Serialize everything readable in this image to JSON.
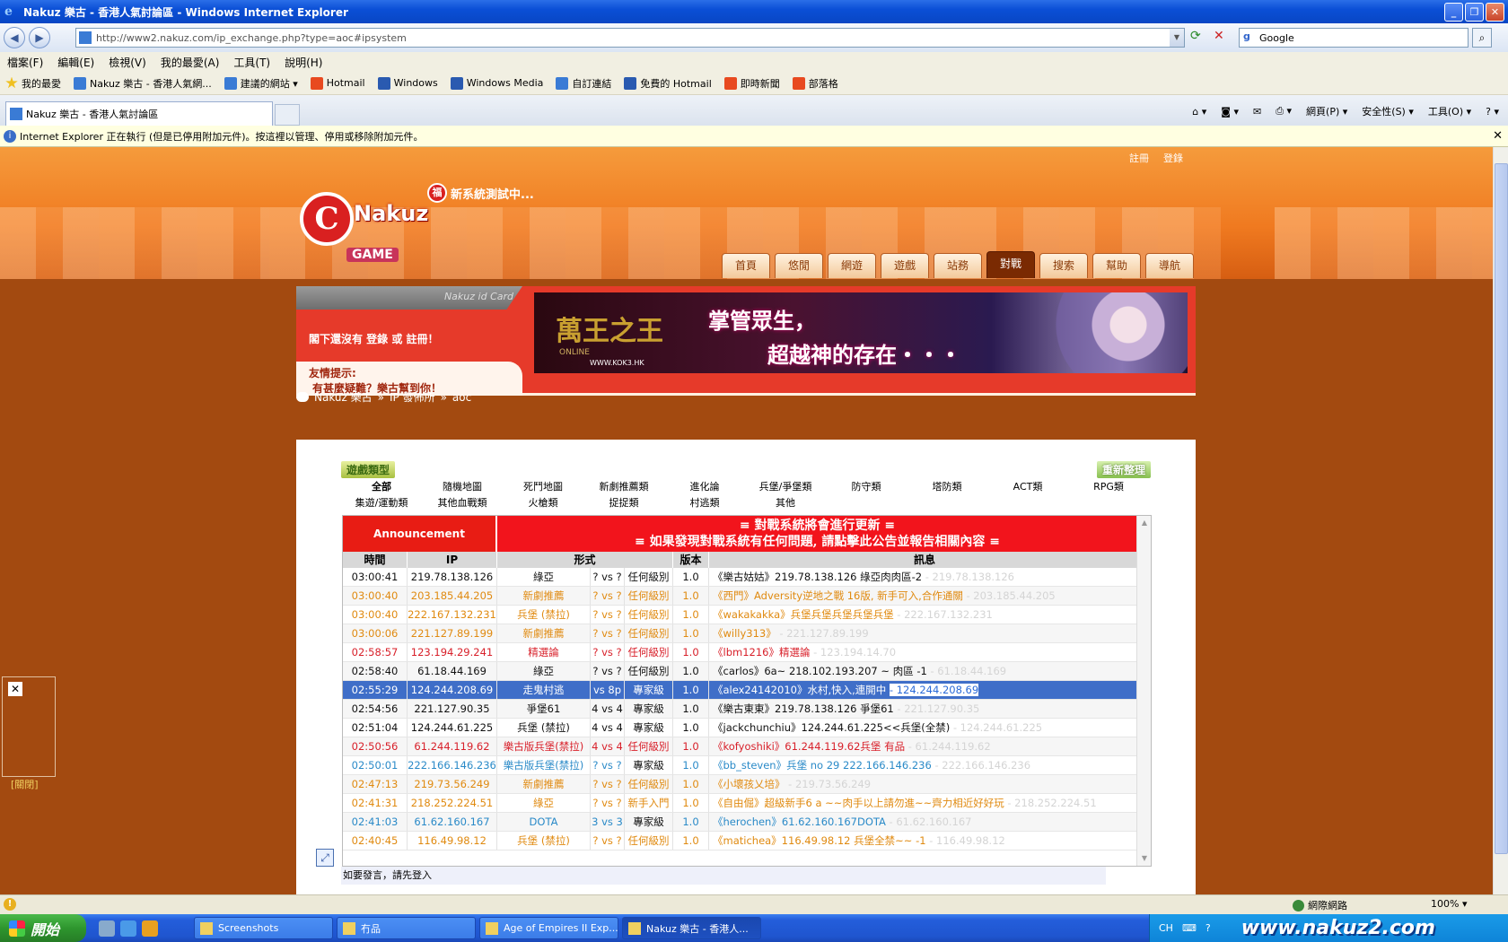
{
  "window": {
    "title": "Nakuz 樂古 - 香港人氣討論區 - Windows Internet Explorer"
  },
  "addressbar": {
    "url": "http://www2.nakuz.com/ip_exchange.php?type=aoc#ipsystem",
    "search_value": "Google"
  },
  "menu": [
    "檔案(F)",
    "編輯(E)",
    "檢視(V)",
    "我的最愛(A)",
    "工具(T)",
    "說明(H)"
  ],
  "favorites": {
    "label": "我的最愛",
    "items": [
      "Nakuz 樂古 - 香港人氣網...",
      "建議的網站 ▾",
      "Hotmail",
      "Windows",
      "Windows Media",
      "自訂連結",
      "免費的 Hotmail",
      "即時新聞",
      "部落格"
    ]
  },
  "tab": {
    "label": "Nakuz 樂古 - 香港人氣討論區"
  },
  "commandbar": [
    "網頁(P) ▾",
    "安全性(S) ▾",
    "工具(O) ▾"
  ],
  "infobar": {
    "text": "Internet Explorer 正在執行 (但是已停用附加元件)。按這裡以管理、停用或移除附加元件。"
  },
  "site": {
    "login_links": [
      "註冊",
      "登錄"
    ],
    "logo_word": "Nakuz",
    "logo_letter": "C",
    "logo_game": "GAME",
    "testing_badge": "福",
    "testing_text": "新系統測試中...",
    "nav": [
      "首頁",
      "悠閒",
      "網遊",
      "遊戲",
      "站務",
      "對戰",
      "搜索",
      "幫助",
      "導航"
    ],
    "active_nav": "對戰"
  },
  "idcard": {
    "header": "Nakuz id Card",
    "body": "閣下還沒有 登錄 或 註冊！",
    "tip_title": "友情提示:",
    "tip_text": "有甚麼疑難？樂古幫到你！"
  },
  "ad": {
    "game_title": "萬王之王",
    "sub": "ONLINE",
    "url": "WWW.KOK3.HK",
    "slogan1": "掌管眾生，",
    "slogan2": "超越神的存在・・・"
  },
  "breadcrumb": [
    "Nakuz 樂古",
    "»",
    "IP 發佈所",
    "»",
    "aoc"
  ],
  "panel": {
    "gametype_label": "遊戲類型",
    "refresh_label": "重新整理",
    "categories_row1": [
      "全部",
      "隨機地圖",
      "死鬥地圖",
      "新劇推薦類",
      "進化論",
      "兵堡/爭堡類",
      "防守類",
      "塔防類",
      "ACT類",
      "RPG類"
    ],
    "categories_row2": [
      "集遊/運動類",
      "其他血戰類",
      "火槍類",
      "捉捉類",
      "村逃類",
      "其他"
    ],
    "announce_label": "Announcement",
    "announce_line1": "≡ 對戰系統將會進行更新 ≡",
    "announce_line2": "≡ 如果發現對戰系統有任何問題, 請點擊此公告並報告相關內容 ≡",
    "headers": {
      "time": "時間",
      "ip": "IP",
      "mode": "形式",
      "version": "版本",
      "message": "訊息"
    },
    "rows": [
      {
        "time": "03:00:41",
        "ip": "219.78.138.126",
        "mode": "綠亞",
        "vs": "? vs ?",
        "level": "任何級別",
        "ver": "1.0",
        "msg": "《樂古姑姑》219.78.138.126 綠亞肉肉區-2",
        "tail": "- 219.78.138.126",
        "color": "black"
      },
      {
        "time": "03:00:40",
        "ip": "203.185.44.205",
        "mode": "新劇推薦",
        "vs": "? vs ?",
        "level": "任何級別",
        "ver": "1.0",
        "msg": "《西門》Adversity逆地之戰 16版, 新手可入,合作通關",
        "tail": "- 203.185.44.205",
        "color": "orange"
      },
      {
        "time": "03:00:40",
        "ip": "222.167.132.231",
        "mode": "兵堡 (禁拉)",
        "vs": "? vs ?",
        "level": "任何級別",
        "ver": "1.0",
        "msg": "《wakakakka》兵堡兵堡兵堡兵堡兵堡",
        "tail": "- 222.167.132.231",
        "color": "orange"
      },
      {
        "time": "03:00:06",
        "ip": "221.127.89.199",
        "mode": "新劇推薦",
        "vs": "? vs ?",
        "level": "任何級別",
        "ver": "1.0",
        "msg": "《willy313》",
        "tail": "- 221.127.89.199",
        "color": "orange"
      },
      {
        "time": "02:58:57",
        "ip": "123.194.29.241",
        "mode": "精選論",
        "vs": "? vs ?",
        "level": "任何級別",
        "ver": "1.0",
        "msg": "《lbm1216》精選論",
        "tail": "- 123.194.14.70",
        "color": "red"
      },
      {
        "time": "02:58:40",
        "ip": "61.18.44.169",
        "mode": "綠亞",
        "vs": "? vs ?",
        "level": "任何級別",
        "ver": "1.0",
        "msg": "《carlos》6a~ 218.102.193.207 ~ 肉區 -1",
        "tail": "- 61.18.44.169",
        "color": "black"
      },
      {
        "time": "02:55:29",
        "ip": "124.244.208.69",
        "mode": "走鬼村逃",
        "vs": "vs 8p",
        "level": "專家級",
        "ver": "1.0",
        "msg": "《alex24142010》水村,快入,連開中",
        "tail": "- 124.244.208.69",
        "color": "sel"
      },
      {
        "time": "02:54:56",
        "ip": "221.127.90.35",
        "mode": "爭堡61",
        "vs": "4 vs 4",
        "level": "專家級",
        "ver": "1.0",
        "msg": "《樂古東東》219.78.138.126 爭堡61",
        "tail": "- 221.127.90.35",
        "color": "black"
      },
      {
        "time": "02:51:04",
        "ip": "124.244.61.225",
        "mode": "兵堡 (禁拉)",
        "vs": "4 vs 4",
        "level": "專家級",
        "ver": "1.0",
        "msg": "《jackchunchiu》124.244.61.225<<兵堡(全禁)",
        "tail": "- 124.244.61.225",
        "color": "black"
      },
      {
        "time": "02:50:56",
        "ip": "61.244.119.62",
        "mode": "樂古版兵堡(禁拉)",
        "vs": "4 vs 4",
        "level": "任何級別",
        "ver": "1.0",
        "msg": "《kofyoshiki》61.244.119.62兵堡 有品",
        "tail": "- 61.244.119.62",
        "color": "red"
      },
      {
        "time": "02:50:01",
        "ip": "222.166.146.236",
        "mode": "樂古版兵堡(禁拉)",
        "vs": "? vs ?",
        "level": "專家級",
        "ver": "1.0",
        "msg": "《bb_steven》兵堡 no 29 222.166.146.236",
        "tail": "- 222.166.146.236",
        "color": "blue"
      },
      {
        "time": "02:47:13",
        "ip": "219.73.56.249",
        "mode": "新劇推薦",
        "vs": "? vs ?",
        "level": "任何級別",
        "ver": "1.0",
        "msg": "《小壞孩乂培》",
        "tail": "- 219.73.56.249",
        "color": "orange"
      },
      {
        "time": "02:41:31",
        "ip": "218.252.224.51",
        "mode": "綠亞",
        "vs": "? vs ?",
        "level": "新手入門",
        "ver": "1.0",
        "msg": "《自由倔》超級新手6 a ~~肉手以上請勿進~~齊力相近好好玩",
        "tail": "- 218.252.224.51",
        "color": "orange"
      },
      {
        "time": "02:41:03",
        "ip": "61.62.160.167",
        "mode": "DOTA",
        "vs": "3 vs 3",
        "level": "專家級",
        "ver": "1.0",
        "msg": "《herochen》61.62.160.167DOTA",
        "tail": "- 61.62.160.167",
        "color": "blue"
      },
      {
        "time": "02:40:45",
        "ip": "116.49.98.12",
        "mode": "兵堡 (禁拉)",
        "vs": "? vs ?",
        "level": "任何級別",
        "ver": "1.0",
        "msg": "《matichea》116.49.98.12 兵堡全禁~~ -1",
        "tail": "- 116.49.98.12",
        "color": "orange"
      }
    ],
    "login_hint": "如要發言，請先登入"
  },
  "floater": {
    "close_label": "[關閉]"
  },
  "status": {
    "zone": "網際網路",
    "zoom": "100% ▾"
  },
  "taskbar": {
    "start": "開始",
    "items": [
      "Screenshots",
      "冇品",
      "Age of Empires II Exp...",
      "Nakuz 樂古 - 香港人..."
    ],
    "tray_lang": "CH",
    "watermark": "www.nakuz2.com"
  }
}
